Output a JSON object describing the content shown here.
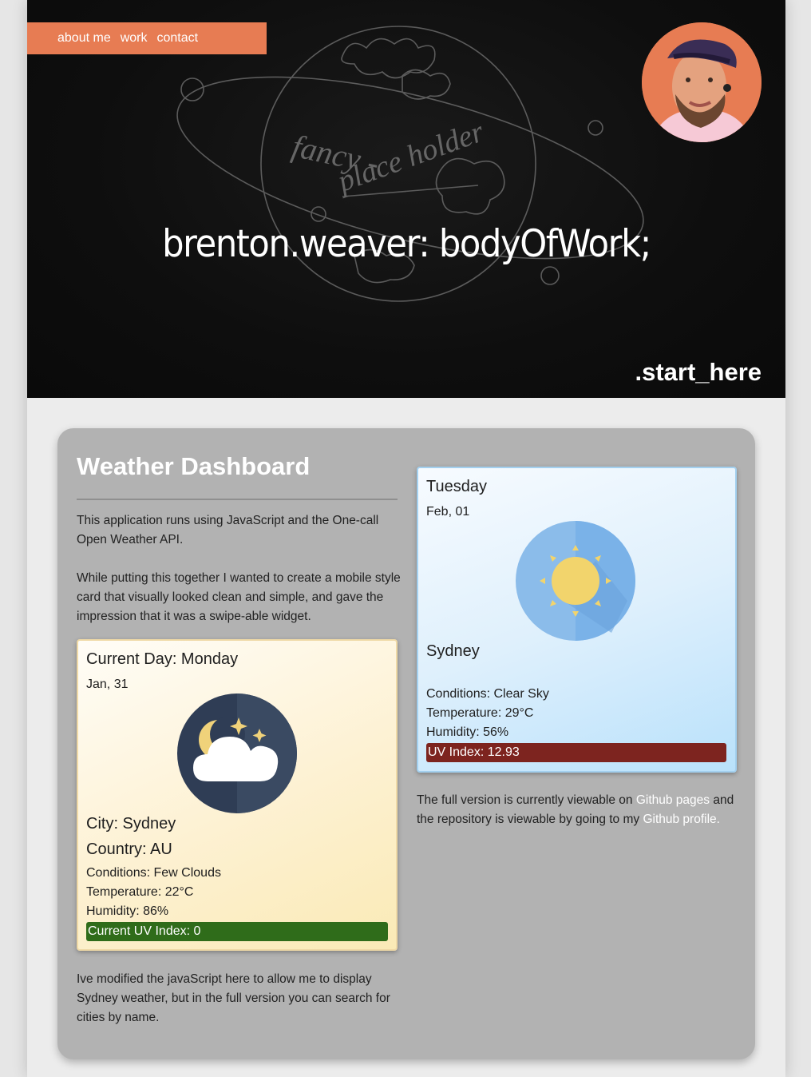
{
  "nav": {
    "items": [
      "about me",
      "work",
      "contact"
    ]
  },
  "hero": {
    "title": "brenton.weaver: bodyOfWork;",
    "sketch_text_1": "fancy -",
    "sketch_text_2": "place holder",
    "start_here": ".start_here"
  },
  "project": {
    "title": "Weather Dashboard",
    "intro": "This application runs using JavaScript and the One-call Open Weather API.",
    "intro2": "While putting this together I wanted to create a mobile style card that visually looked clean and simple, and gave the impression that it was a swipe-able widget.",
    "footnote": "Ive modified the javaScript here to allow me to display Sydney weather, but in the full version you can search for cities by name.",
    "full_version_prefix": "The full version is currently viewable on ",
    "link_pages": "Github pages",
    "full_version_middle": " and the repository is viewable by going to my ",
    "link_profile": "Github profile."
  },
  "current_card": {
    "day": "Current Day: Monday",
    "date": "Jan, 31",
    "city": "City: Sydney",
    "country": "Country: AU",
    "conditions": "Conditions: Few Clouds",
    "temperature": "Temperature: 22°C",
    "humidity": "Humidity: 86%",
    "uv": "Current UV Index: 0",
    "uv_color": "#2f6c1a",
    "icon": "cloudy-night-icon"
  },
  "forecast_card": {
    "day": "Tuesday",
    "date": "Feb, 01",
    "city": "Sydney",
    "conditions": "Conditions: Clear Sky",
    "temperature": "Temperature: 29°C",
    "humidity": "Humidity: 56%",
    "uv": "UV Index: 12.93",
    "uv_color": "#7d241f",
    "icon": "sun-icon"
  },
  "colors": {
    "accent": "#e77c53",
    "panel": "#b2b2b2"
  }
}
